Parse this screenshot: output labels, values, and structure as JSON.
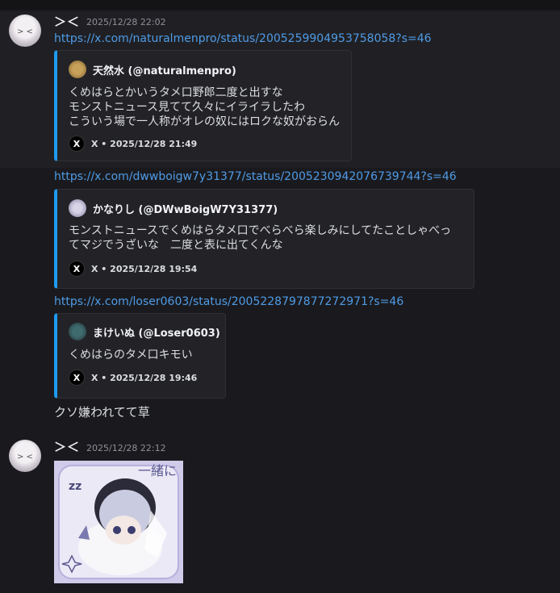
{
  "messages": [
    {
      "author": "＞＜",
      "timestamp": "2025/12/28 22:02",
      "links": [
        "https://x.com/naturalmenpro/status/2005259904953758058?s=46",
        "https://x.com/dwwboigw7y31377/status/2005230942076739744?s=46",
        "https://x.com/loser0603/status/2005228797877272971?s=46"
      ],
      "embeds": [
        {
          "author": "天然水 (@naturalmenpro)",
          "text": "くめはらとかいうタメ口野郎二度と出すな\nモンストニュース見てて久々にイライラしたわ\nこういう場で一人称がオレの奴にはロクな奴がおらん",
          "footer": "X • 2025/12/28 21:49",
          "footer_icon": "X"
        },
        {
          "author": "かなりし (@DWwBoigW7Y31377)",
          "text": "モンストニュースでくめはらタメ口でべらべら楽しみにしてたことしゃべっ\nてマジでうざいな　二度と表に出てくんな",
          "footer": "X • 2025/12/28 19:54",
          "footer_icon": "X"
        },
        {
          "author": "まけいぬ (@Loser0603)",
          "text": "くめはらのタメ口キモい",
          "footer": "X • 2025/12/28 19:46",
          "footer_icon": "X"
        }
      ],
      "text": "クソ嫌われてて草"
    },
    {
      "author": "＞＜",
      "timestamp": "2025/12/28 22:12",
      "image_text": [
        "一緒に",
        "zz"
      ]
    }
  ],
  "colors": {
    "link": "#4f9be6",
    "embed_border": "#1d9bf0",
    "background": "#1a1a1e"
  }
}
